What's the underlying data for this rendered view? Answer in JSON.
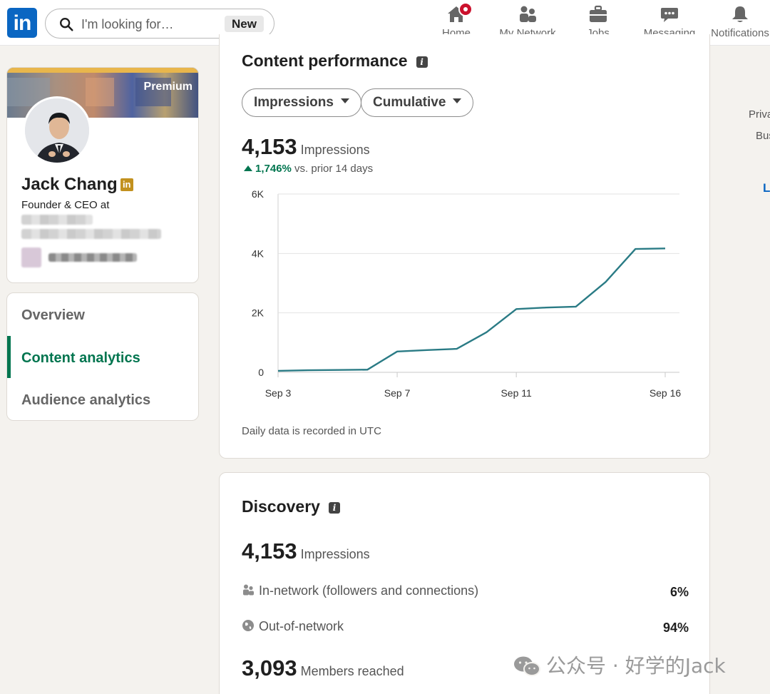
{
  "nav": {
    "logo": "in",
    "search_placeholder": "I'm looking for…",
    "search_badge": "New",
    "items": [
      {
        "label": "Home",
        "icon": "home-icon"
      },
      {
        "label": "My Network",
        "icon": "network-icon"
      },
      {
        "label": "Jobs",
        "icon": "briefcase-icon"
      },
      {
        "label": "Messaging",
        "icon": "messaging-icon"
      },
      {
        "label": "Notifications",
        "icon": "bell-icon"
      }
    ]
  },
  "profile": {
    "badge": "Premium",
    "name": "Jack Chang",
    "name_badge": "in",
    "headline": "Founder & CEO at"
  },
  "menu": {
    "items": [
      {
        "label": "Overview",
        "active": false
      },
      {
        "label": "Content analytics",
        "active": true
      },
      {
        "label": "Audience analytics",
        "active": false
      }
    ]
  },
  "content_performance": {
    "title": "Content performance",
    "metric_dropdown": "Impressions",
    "mode_dropdown": "Cumulative",
    "total": "4,153",
    "total_unit": "Impressions",
    "delta_pct": "1,746%",
    "delta_text": "vs. prior 14 days",
    "footnote": "Daily data is recorded in UTC"
  },
  "chart_data": {
    "type": "line",
    "x": [
      "Sep 3",
      "Sep 4",
      "Sep 5",
      "Sep 6",
      "Sep 7",
      "Sep 8",
      "Sep 9",
      "Sep 10",
      "Sep 11",
      "Sep 12",
      "Sep 13",
      "Sep 14",
      "Sep 15",
      "Sep 16"
    ],
    "values": [
      50,
      70,
      80,
      90,
      700,
      750,
      790,
      1350,
      2130,
      2180,
      2210,
      3040,
      4150,
      4170
    ],
    "x_tick_labels": [
      "Sep 3",
      "Sep 7",
      "Sep 11",
      "Sep 16"
    ],
    "y_ticks": [
      0,
      2000,
      4000,
      6000
    ],
    "y_tick_labels": [
      "0",
      "2K",
      "4K",
      "6K"
    ],
    "ylim": [
      0,
      6000
    ],
    "grid": true,
    "line_color": "#2a7b85"
  },
  "discovery": {
    "title": "Discovery",
    "impressions": "4,153",
    "impressions_unit": "Impressions",
    "rows": [
      {
        "label": "In-network (followers and connections)",
        "value": "6%",
        "icon": "people-icon"
      },
      {
        "label": "Out-of-network",
        "value": "94%",
        "icon": "globe-icon"
      }
    ],
    "members": "3,093",
    "members_unit": "Members reached"
  },
  "right_rail": {
    "items": [
      "Priva",
      "Bus",
      "L"
    ]
  },
  "watermark": "公众号 · 好学的Jack",
  "colors": {
    "brand": "#0a66c2",
    "active": "#01754f",
    "notif": "#cb112d"
  }
}
